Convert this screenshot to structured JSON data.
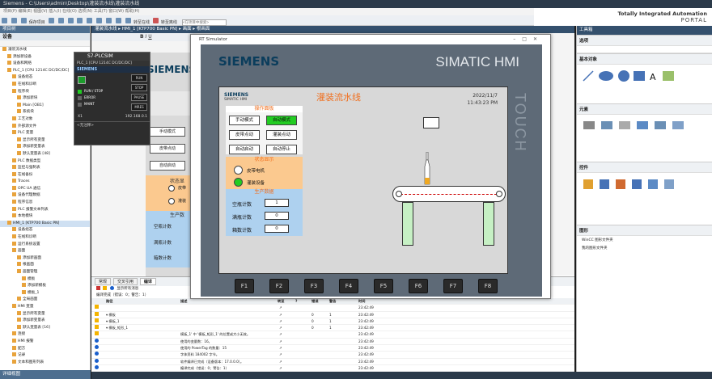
{
  "window": {
    "title": "Siemens - C:\\Users\\admin\\Desktop\\灌装流水线\\灌装流水线",
    "brand_line1": "Totally Integrated Automation",
    "brand_line2": "PORTAL"
  },
  "menubar": {
    "text": "项目(P)  编辑(E)  视图(V)  插入(I)  在线(O)  选项(N)  工具(T)  窗口(W)  帮助(H)"
  },
  "toolbar": {
    "save_label": "保存项目",
    "go_online": "转至在线",
    "go_offline": "转至离线",
    "search_placeholder": "<在项目中搜索>"
  },
  "tree": {
    "header": "项目树",
    "devices_tab": "设备",
    "items": [
      "灌装流水线",
      "添加新设备",
      "设备和网络",
      "PLC_1 [CPU 1214C DC/DC/DC]",
      "设备组态",
      "在线和诊断",
      "程序块",
      "添加新块",
      "Main [OB1]",
      "系统块",
      "工艺对象",
      "外部源文件",
      "PLC 变量",
      "显示所有变量",
      "添加新变量表",
      "默认变量表 [48]",
      "PLC 数据类型",
      "监控与强制表",
      "在线备份",
      "Traces",
      "OPC UA 通信",
      "设备代理数据",
      "程序信息",
      "PLC 报警文本列表",
      "本地模块",
      "HMI_1 [KTP700 Basic PN]",
      "设备组态",
      "在线和诊断",
      "运行系统设置",
      "画面",
      "添加新画面",
      "根画面",
      "画面管理",
      "模板",
      "添加新模板",
      "模板_1",
      "全局画面",
      "HMI 变量",
      "显示所有变量",
      "添加新变量表",
      "默认变量表 [16]",
      "连接",
      "HMI 报警",
      "配方",
      "记录",
      "文本和图形列表"
    ],
    "details": "详细视图"
  },
  "editor": {
    "breadcrumb": "灌装流水线 ▸ HMI_1 [KTP700 Basic PN] ▸ 画面 ▸ 根画面",
    "under_siemens": "SIEMENS",
    "under_buttons": [
      "手动模式",
      "皮带点动",
      "自动启动"
    ],
    "under_status": "状态显",
    "under_lamps": [
      "皮带",
      "灌装"
    ],
    "under_prod": "生产数",
    "under_labels": [
      "空瓶计数",
      "满瓶计数",
      "箱数计数"
    ]
  },
  "plc_sim": {
    "title": "S7-PLCSIM",
    "cpu": "PLC_1 [CPU 1214C DC/DC/DC]",
    "brand": "SIEMENS",
    "leds": [
      "RUN / STOP",
      "ERROR",
      "MAINT"
    ],
    "buttons": [
      "RUN",
      "STOP",
      "PAUSE",
      "MRES"
    ],
    "ip_label": "X1",
    "ip": "192.168.0.1",
    "note": "<无注释>"
  },
  "simulator": {
    "title": "RT Simulator",
    "brand": "SIEMENS",
    "product": "SIMATIC HMI",
    "touch": "TOUCH",
    "fkeys": [
      "F1",
      "F2",
      "F3",
      "F4",
      "F5",
      "F6",
      "F7",
      "F8"
    ],
    "screen": {
      "brand": "SIEMENS",
      "product": "SIMATIC HMI",
      "title": "灌装流水线",
      "date": "2022/11/7",
      "time": "11:43:23 PM",
      "op_panel_title": "操作面板",
      "op_buttons": [
        "手动模式",
        "自动模式",
        "皮带点动",
        "灌装点动",
        "自动启动",
        "自动停止"
      ],
      "active_button": "自动模式",
      "status_title": "状态显示",
      "lamps": [
        {
          "label": "皮带电机",
          "state": "off",
          "color": "#ffffff"
        },
        {
          "label": "灌装设备",
          "state": "on",
          "color": "#22cc22"
        }
      ],
      "prod_title": "生产数据",
      "prod_rows": [
        {
          "label": "空瓶计数",
          "value": "1"
        },
        {
          "label": "满瓶计数",
          "value": "0"
        },
        {
          "label": "箱数计数",
          "value": "0"
        }
      ]
    }
  },
  "inspector": {
    "tabs": [
      "常规",
      "交叉引用",
      "编译"
    ],
    "filter_label": "显示所有消息",
    "summary": "编译完成（错误：0；警告：1）",
    "columns": [
      "路径",
      "描述",
      "转至",
      "?",
      "错误",
      "警告",
      "时间"
    ],
    "rows": [
      {
        "icon": "warn",
        "path": "",
        "desc": "",
        "err": "",
        "wrn": "",
        "time": "23:42:49"
      },
      {
        "icon": "warn",
        "path": "▾ 模板",
        "desc": "",
        "err": "0",
        "wrn": "1",
        "time": "23:42:49"
      },
      {
        "icon": "warn",
        "path": "▾ 模板_1",
        "desc": "",
        "err": "0",
        "wrn": "1",
        "time": "23:42:49"
      },
      {
        "icon": "warn",
        "path": "▾ 模板_矩形_1",
        "desc": "",
        "err": "0",
        "wrn": "1",
        "time": "23:42:49"
      },
      {
        "icon": "warn",
        "path": "",
        "desc": "模板_1' 中 '模板_矩形_1' 的位置或大小无效。",
        "err": "",
        "wrn": "",
        "time": "23:42:49"
      },
      {
        "icon": "info",
        "path": "",
        "desc": "使用的变量数：16。",
        "err": "",
        "wrn": "",
        "time": "23:42:49"
      },
      {
        "icon": "info",
        "path": "",
        "desc": "使用的 PowerTag 的数量：15",
        "err": "",
        "wrn": "",
        "time": "23:42:49"
      },
      {
        "icon": "info",
        "path": "",
        "desc": "字体资料 184002 字节。",
        "err": "",
        "wrn": "",
        "time": "23:42:49"
      },
      {
        "icon": "info",
        "path": "",
        "desc": "软件编译已完成（设备版本：17.0.0.0）。",
        "err": "",
        "wrn": "",
        "time": "23:42:49"
      },
      {
        "icon": "info",
        "path": "",
        "desc": "编译完成（错误：0；警告：1）",
        "err": "",
        "wrn": "",
        "time": "23:42:49"
      }
    ]
  },
  "right": {
    "header": "工具箱",
    "options": "选项",
    "sections": [
      "基本对象",
      "元素",
      "控件",
      "图形"
    ],
    "graphics_items": [
      "WinCC 图形文件夹",
      "我的图形文件夹"
    ]
  },
  "colors": {
    "accent": "#34506d",
    "active_green": "#22cc22",
    "orange": "#f07020",
    "hmi_body": "#5e6a77"
  }
}
